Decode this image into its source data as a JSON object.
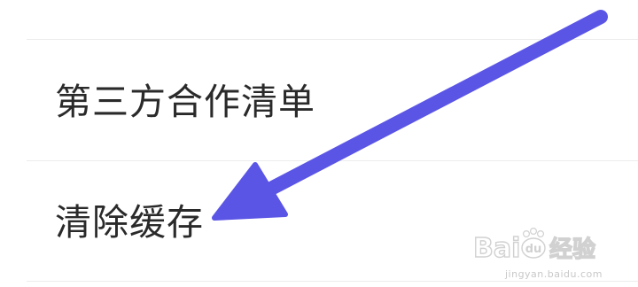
{
  "settings_list": {
    "items": [
      {
        "label": "第三方合作清单"
      },
      {
        "label": "清除缓存"
      }
    ]
  },
  "annotation": {
    "arrow_color": "#5b55e6"
  },
  "watermark": {
    "brand_latin": "Bai",
    "brand_mark": "du",
    "brand_cn": "经验",
    "url": "jingyan.baidu.com"
  }
}
